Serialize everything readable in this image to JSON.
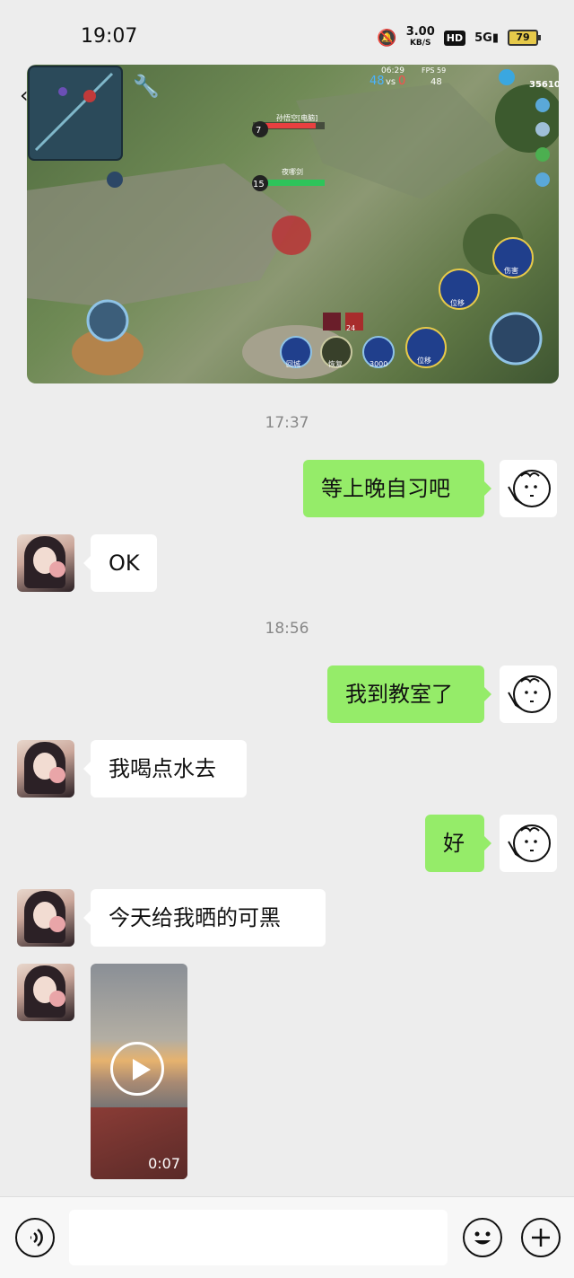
{
  "status_bar": {
    "time": "19:07",
    "speed_value": "3.00",
    "speed_unit": "KB/S",
    "hd": "HD",
    "network": "5G",
    "battery": "79"
  },
  "game_screenshot": {
    "match_time": "06:29",
    "fps": "FPS 59",
    "score_left": "48",
    "score_vs": "vs",
    "score_right": "0",
    "kills": "48",
    "gold": "35610",
    "hero_name_1": "孙悟空[电脑]",
    "hero_level_1": "7",
    "hero_name_2": "夜哪剑",
    "hero_level_2": "15",
    "skill_labels": [
      "回城",
      "恢复",
      "3000",
      "位移",
      "位移",
      "伤害"
    ],
    "buff_count": "24"
  },
  "chat": {
    "timestamps": [
      "17:37",
      "18:56"
    ],
    "messages": [
      {
        "from": "me",
        "text": "等上晚自习吧"
      },
      {
        "from": "other",
        "text": "OK"
      },
      {
        "from": "me",
        "text": "我到教室了"
      },
      {
        "from": "other",
        "text": "我喝点水去"
      },
      {
        "from": "me",
        "text": "好"
      },
      {
        "from": "other",
        "text": "今天给我晒的可黑"
      }
    ],
    "video": {
      "duration": "0:07"
    }
  },
  "input_bar": {
    "placeholder": ""
  },
  "colors": {
    "bg": "#ededed",
    "out_bubble": "#95ec69",
    "in_bubble": "#ffffff"
  }
}
